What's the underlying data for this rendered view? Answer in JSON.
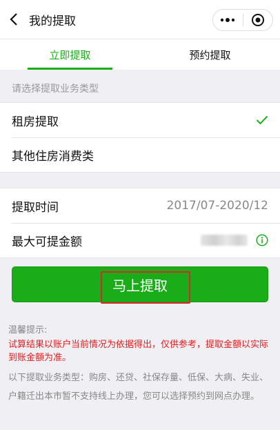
{
  "nav": {
    "title": "我的提取",
    "back_icon": "chevron-left-icon",
    "more_icon": "more-dots-icon",
    "close_icon": "target-close-icon"
  },
  "tabs": [
    {
      "label": "立即提取",
      "active": true
    },
    {
      "label": "预约提取",
      "active": false
    }
  ],
  "business_type": {
    "hint": "请选择提取业务类型",
    "options": [
      {
        "label": "租房提取",
        "selected": true
      },
      {
        "label": "其他住房消费类",
        "selected": false
      }
    ]
  },
  "details": {
    "time_label": "提取时间",
    "time_value": "2017/07-2020/12",
    "max_amount_label": "最大可提金额"
  },
  "submit": {
    "label": "马上提取"
  },
  "tips": {
    "title": "温馨提示:",
    "warning": "试算结果以账户当前情况为依据得出，仅供参考，提取金额以实际到账金额为准。",
    "note": "以下提取业务类型：购房、还贷、社保存量、低保、大病、失业、户籍迁出本市暂不支持线上办理，您可以选择预约到网点办理。"
  },
  "colors": {
    "accent": "#1aad19",
    "warning": "#e02020",
    "highlight_box": "#d9272e"
  }
}
